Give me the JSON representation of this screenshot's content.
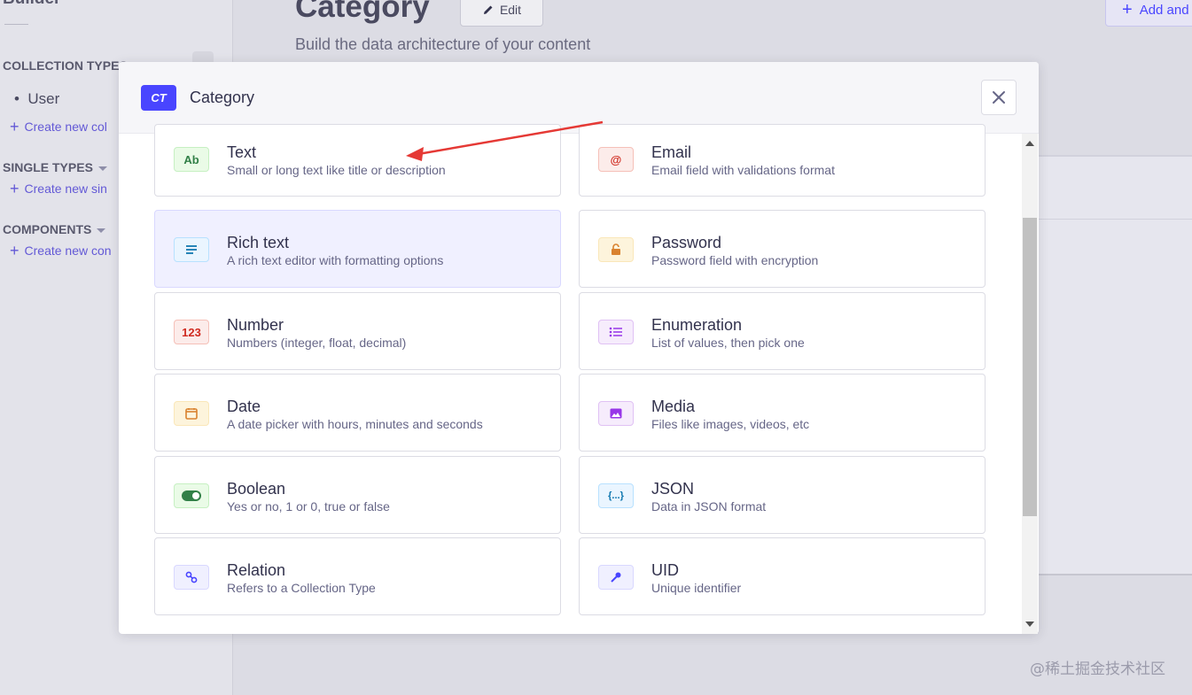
{
  "sidebar": {
    "brand": "Builder",
    "sections": [
      {
        "title": "COLLECTION TYPES",
        "items": [
          "User"
        ],
        "create_link": "Create new col"
      },
      {
        "title": "SINGLE TYPES",
        "create_link": "Create new sin"
      },
      {
        "title": "COMPONENTS",
        "create_link": "Create new con"
      }
    ]
  },
  "main": {
    "title": "Category",
    "edit_label": "Edit",
    "subtitle": "Build the data architecture of your content",
    "add_label": "Add and"
  },
  "modal": {
    "badge": "CT",
    "title": "Category",
    "close_icon": "close-icon",
    "cards": [
      {
        "label": "Text",
        "description": "Small or long text like title or description",
        "icon_text": "Ab",
        "icon": "text-icon",
        "icon_bg": "#eafbe7",
        "icon_fg": "#328048",
        "icon_border": "#c6f0c2"
      },
      {
        "label": "Email",
        "description": "Email field with validations format",
        "icon_text": "@",
        "icon": "email-icon",
        "icon_bg": "#fcecea",
        "icon_fg": "#d02b20",
        "icon_border": "#f5c0b8"
      },
      {
        "label": "Rich text",
        "description": "A rich text editor with formatting options",
        "icon_text": "",
        "icon": "richtext-icon",
        "icon_bg": "#eaf5ff",
        "icon_fg": "#0c75af",
        "icon_border": "#b8e1ff",
        "active": true
      },
      {
        "label": "Password",
        "description": "Password field with encryption",
        "icon_text": "",
        "icon": "lock-icon",
        "icon_bg": "#fdf4dc",
        "icon_fg": "#d9822f",
        "icon_border": "#fae7b9"
      },
      {
        "label": "Number",
        "description": "Numbers (integer, float, decimal)",
        "icon_text": "123",
        "icon": "number-icon",
        "icon_bg": "#fcecea",
        "icon_fg": "#d02b20",
        "icon_border": "#f5c0b8"
      },
      {
        "label": "Enumeration",
        "description": "List of values, then pick one",
        "icon_text": "",
        "icon": "list-icon",
        "icon_bg": "#f6ecfc",
        "icon_fg": "#9736e8",
        "icon_border": "#e0c1f4"
      },
      {
        "label": "Date",
        "description": "A date picker with hours, minutes and seconds",
        "icon_text": "",
        "icon": "calendar-icon",
        "icon_bg": "#fdf4dc",
        "icon_fg": "#d9822f",
        "icon_border": "#fae7b9"
      },
      {
        "label": "Media",
        "description": "Files like images, videos, etc",
        "icon_text": "",
        "icon": "image-icon",
        "icon_bg": "#f6ecfc",
        "icon_fg": "#9736e8",
        "icon_border": "#e0c1f4"
      },
      {
        "label": "Boolean",
        "description": "Yes or no, 1 or 0, true or false",
        "icon_text": "",
        "icon": "toggle-icon",
        "icon_bg": "#eafbe7",
        "icon_fg": "#328048",
        "icon_border": "#c6f0c2"
      },
      {
        "label": "JSON",
        "description": "Data in JSON format",
        "icon_text": "{...}",
        "icon": "json-icon",
        "icon_bg": "#eaf5ff",
        "icon_fg": "#0c75af",
        "icon_border": "#b8e1ff"
      },
      {
        "label": "Relation",
        "description": "Refers to a Collection Type",
        "icon_text": "",
        "icon": "link-icon",
        "icon_bg": "#f0f0ff",
        "icon_fg": "#4945ff",
        "icon_border": "#d9d8ff"
      },
      {
        "label": "UID",
        "description": "Unique identifier",
        "icon_text": "",
        "icon": "key-icon",
        "icon_bg": "#f0f0ff",
        "icon_fg": "#4945ff",
        "icon_border": "#d9d8ff"
      }
    ]
  },
  "watermark": "@稀土掘金技术社区",
  "colors": {
    "accent": "#4945ff",
    "annotation_arrow": "#e53935"
  }
}
